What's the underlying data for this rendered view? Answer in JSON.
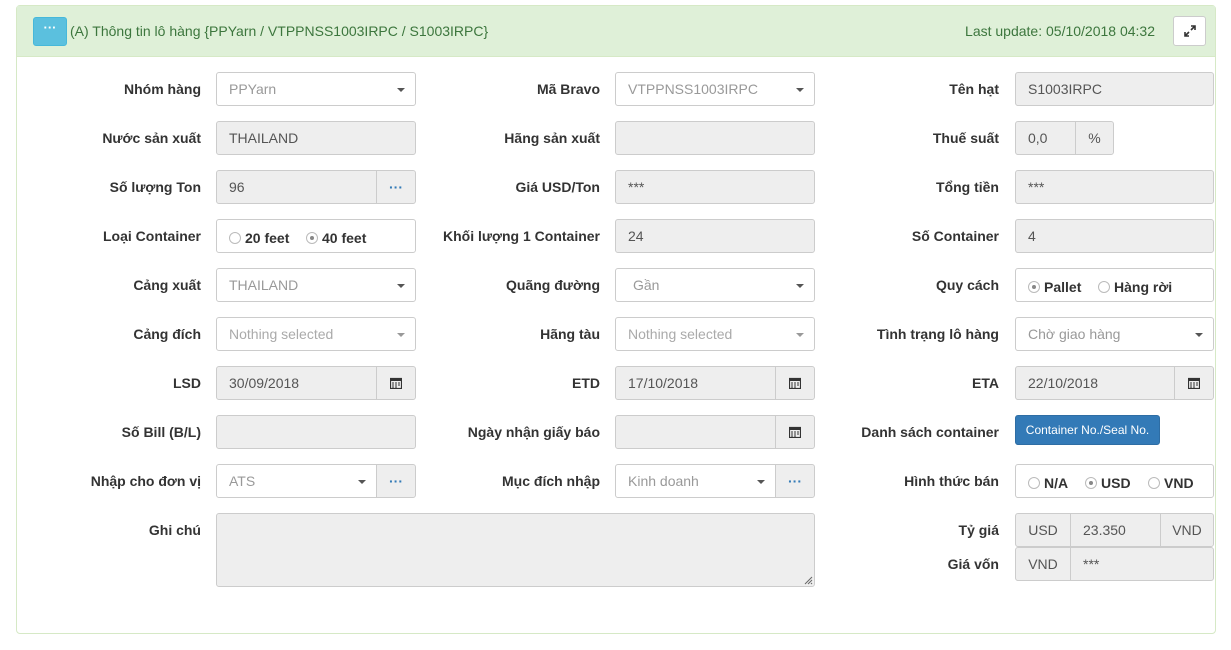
{
  "header": {
    "title": "(A) Thông tin lô hàng {PPYarn / VTPPNSS1003IRPC / S1003IRPC}",
    "last_update": "Last update: 05/10/2018 04:32",
    "collapse_label": "···"
  },
  "fields": {
    "nhom_hang": {
      "label": "Nhóm hàng",
      "value": "PPYarn"
    },
    "ma_bravo": {
      "label": "Mã Bravo",
      "value": "VTPPNSS1003IRPC"
    },
    "ten_hat": {
      "label": "Tên hạt",
      "value": "S1003IRPC"
    },
    "nuoc_san_xuat": {
      "label": "Nước sản xuất",
      "value": "THAILAND"
    },
    "hang_san_xuat": {
      "label": "Hãng sản xuất",
      "value": ""
    },
    "thue_suat": {
      "label": "Thuế suất",
      "value": "0,0",
      "unit": "%"
    },
    "so_luong_ton": {
      "label": "Số lượng Ton",
      "value": "96",
      "button": "···"
    },
    "gia_usd_ton": {
      "label": "Giá USD/Ton",
      "value": "***"
    },
    "tong_tien": {
      "label": "Tổng tiền",
      "value": "***"
    },
    "loai_container": {
      "label": "Loại Container",
      "options": [
        "20 feet",
        "40 feet"
      ],
      "selected": "40 feet"
    },
    "khoi_luong_container": {
      "label": "Khối lượng 1 Container",
      "value": "24"
    },
    "so_container": {
      "label": "Số Container",
      "value": "4"
    },
    "cang_xuat": {
      "label": "Cảng xuất",
      "value": "THAILAND"
    },
    "quang_duong": {
      "label": "Quãng đường",
      "value": "Gần"
    },
    "quy_cach": {
      "label": "Quy cách",
      "options": [
        "Pallet",
        "Hàng rời"
      ],
      "selected": "Pallet"
    },
    "cang_dich": {
      "label": "Cảng đích",
      "placeholder": "Nothing selected"
    },
    "hang_tau": {
      "label": "Hãng tàu",
      "placeholder": "Nothing selected"
    },
    "tinh_trang": {
      "label": "Tình trạng lô hàng",
      "value": "Chờ giao hàng"
    },
    "lsd": {
      "label": "LSD",
      "value": "30/09/2018"
    },
    "etd": {
      "label": "ETD",
      "value": "17/10/2018"
    },
    "eta": {
      "label": "ETA",
      "value": "22/10/2018"
    },
    "so_bill": {
      "label": "Số Bill (B/L)",
      "value": ""
    },
    "ngay_nhan_giay_bao": {
      "label": "Ngày nhận giấy báo",
      "value": ""
    },
    "danh_sach_container": {
      "label": "Danh sách container",
      "button": "Container No./Seal No."
    },
    "nhap_cho_don_vi": {
      "label": "Nhập cho đơn vị",
      "value": "ATS",
      "button": "···"
    },
    "muc_dich_nhap": {
      "label": "Mục đích nhập",
      "value": "Kinh doanh",
      "button": "···"
    },
    "hinh_thuc_ban": {
      "label": "Hình thức bán",
      "options": [
        "N/A",
        "USD",
        "VND"
      ],
      "selected": "USD"
    },
    "ghi_chu": {
      "label": "Ghi chú",
      "value": ""
    },
    "ty_gia": {
      "label": "Tỷ giá",
      "prefix": "USD",
      "value": "23.350",
      "suffix": "VND"
    },
    "gia_von": {
      "label": "Giá vốn",
      "prefix": "VND",
      "value": "***"
    }
  },
  "colors": {
    "heading_bg": "#dff0d8",
    "heading_text": "#3c763d",
    "info_button": "#5bc0de",
    "primary_button": "#337ab7",
    "readonly_bg": "#eeeeee"
  }
}
